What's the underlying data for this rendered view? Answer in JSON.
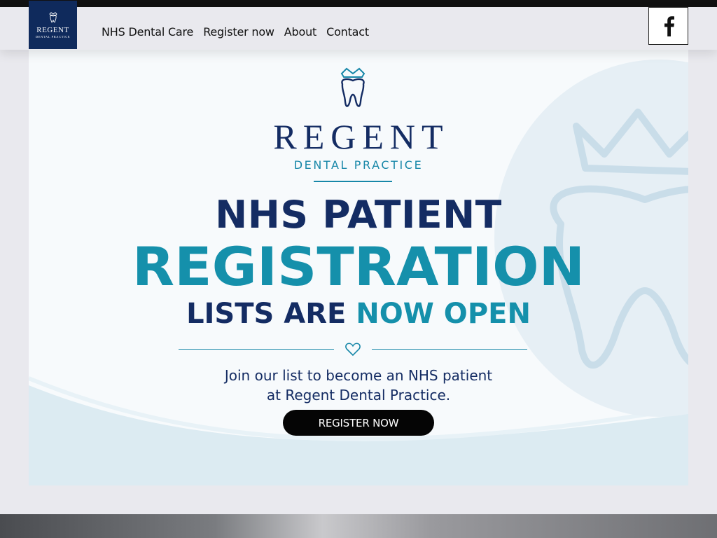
{
  "header": {
    "logo": {
      "name": "REGENT",
      "sub": "DENTAL PRACTICE"
    },
    "nav": [
      {
        "label": "NHS Dental Care"
      },
      {
        "label": "Register now"
      },
      {
        "label": "About"
      },
      {
        "label": "Contact"
      }
    ],
    "social_icon": "facebook-icon"
  },
  "banner": {
    "brand_name": "REGENT",
    "brand_sub": "DENTAL PRACTICE",
    "headline_1": "NHS PATIENT",
    "headline_2": "REGISTRATION",
    "headline_3a": "LISTS ARE",
    "headline_3b": "NOW OPEN",
    "join_line_1": "Join our list to become an NHS patient",
    "join_line_2": "at Regent Dental Practice.",
    "cta_label": "REGISTER NOW",
    "colors": {
      "navy": "#142c63",
      "teal": "#1590ab",
      "button": "#050505"
    }
  }
}
